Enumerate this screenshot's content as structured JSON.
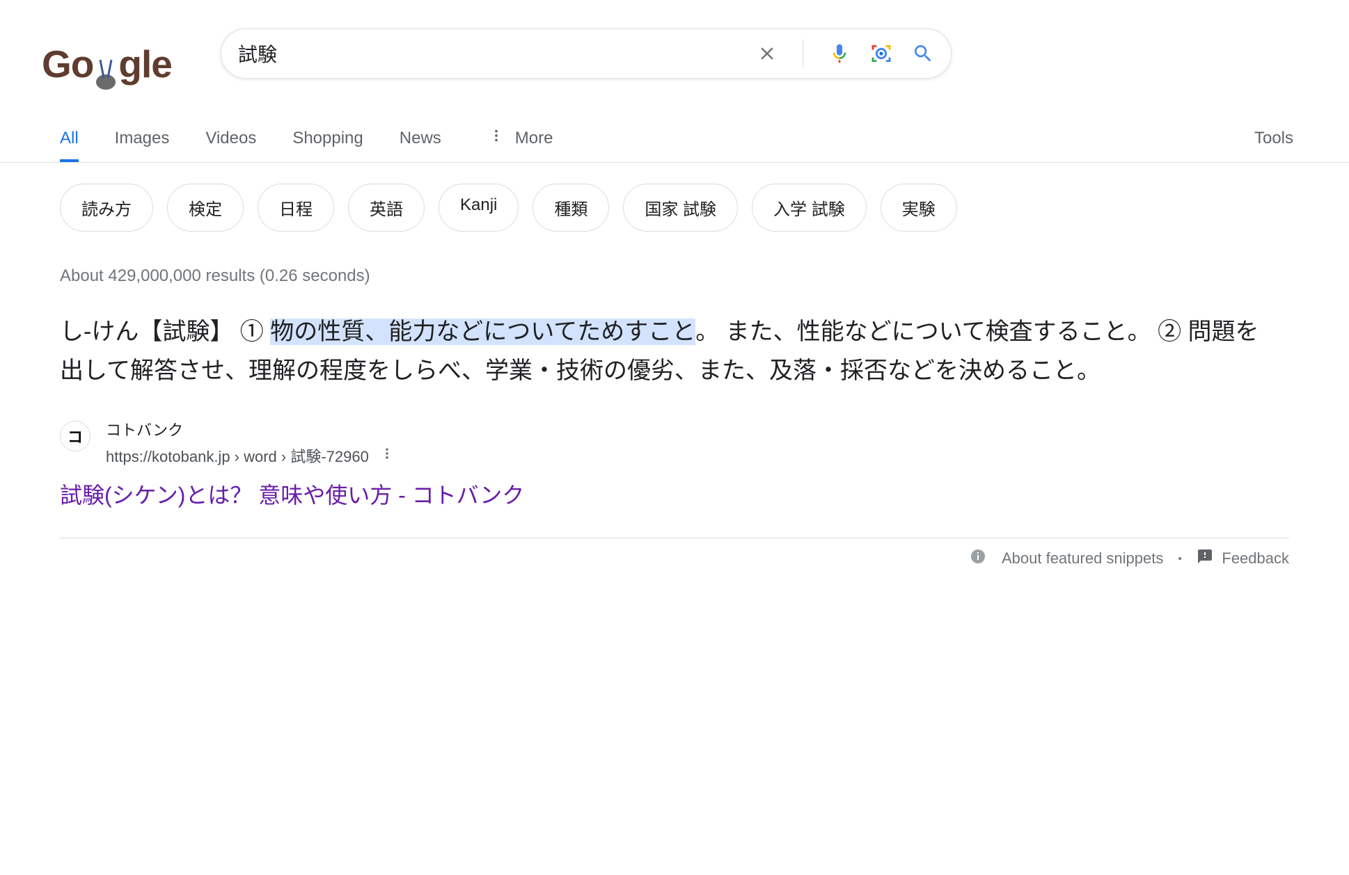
{
  "logo_text": "Google",
  "search": {
    "query": "試験",
    "placeholder": ""
  },
  "tabs": {
    "all": "All",
    "images": "Images",
    "videos": "Videos",
    "shopping": "Shopping",
    "news": "News",
    "more": "More",
    "tools": "Tools"
  },
  "chips": [
    "読み方",
    "検定",
    "日程",
    "英語",
    "Kanji",
    "種類",
    "国家 試験",
    "入学 試験",
    "実験"
  ],
  "result_stats": "About 429,000,000 results (0.26 seconds)",
  "snippet": {
    "prefix": "し‐けん【試験】 ① ",
    "highlight": "物の性質、能力などについてためすこと",
    "suffix": "。 また、性能などについて検査すること。 ② 問題を出して解答させ、理解の程度をしらべ、学業・技術の優劣、また、及落・採否などを決めること。"
  },
  "result": {
    "site_name": "コトバンク",
    "favicon_char": "コ",
    "breadcrumb": "https://kotobank.jp › word › 試験-72960",
    "title": "試験(シケン)とは？ 意味や使い方 - コトバンク"
  },
  "footer": {
    "about": "About featured snippets",
    "feedback": "Feedback"
  }
}
